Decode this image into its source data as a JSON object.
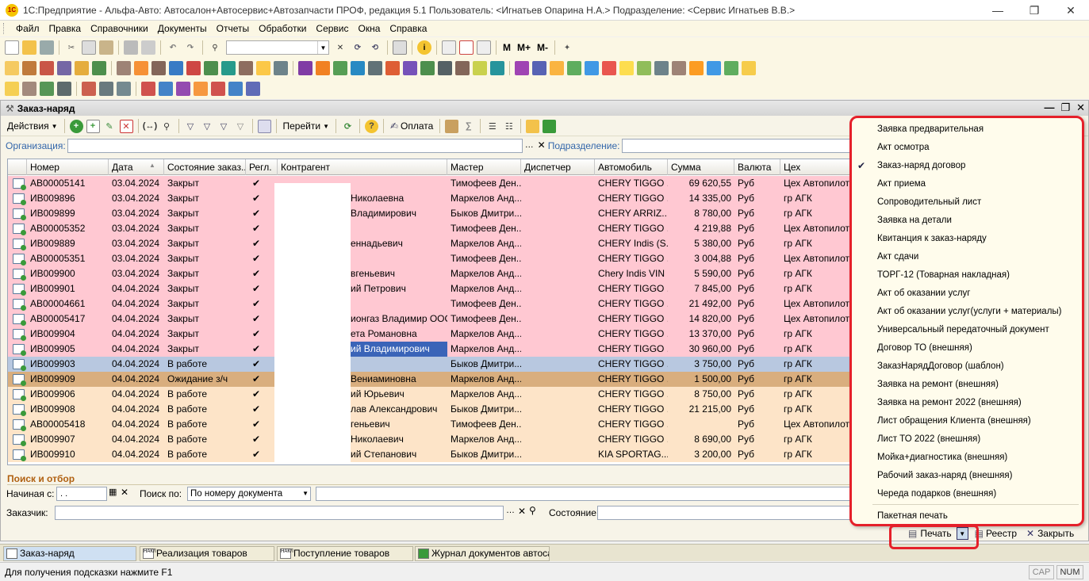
{
  "window": {
    "title": "1С:Предприятие - Альфа-Авто: Автосалон+Автосервис+Автозапчасти ПРОФ, редакция 5.1    Пользователь: <Игнатьев Опарина Н.А.>    Подразделение: <Сервис Игнатьев В.В.>",
    "logo": "1С"
  },
  "menu": [
    "Файл",
    "Правка",
    "Справочники",
    "Документы",
    "Отчеты",
    "Обработки",
    "Сервис",
    "Окна",
    "Справка"
  ],
  "toolbar1": {
    "m_buttons": [
      "M",
      "M+",
      "M-"
    ]
  },
  "doc": {
    "title": "Заказ-наряд",
    "toolbar": {
      "actions": "Действия",
      "goto": "Перейти",
      "pay": "Оплата"
    },
    "filter": {
      "org_label": "Организация:",
      "org_value": "",
      "dept_label": "Подразделение:",
      "dept_value": ""
    },
    "columns": [
      "",
      "Номер",
      "Дата",
      "Состояние заказ...",
      "Регл.",
      "Контрагент",
      "Мастер",
      "Диспетчер",
      "Автомобиль",
      "Сумма",
      "Валюта",
      "Цех"
    ],
    "rows": [
      {
        "num": "АВ00005141",
        "date": "03.04.2024",
        "state": "Закрыт",
        "reg": "✔",
        "contr": "",
        "master": "Тимофеев Ден...",
        "disp": "",
        "car": "CHERY TIGGO ...",
        "sum": "69 620,55",
        "cur": "Руб",
        "shop": "Цех Автопилот",
        "color": "#ffc8d2"
      },
      {
        "num": "ИВ009896",
        "date": "03.04.2024",
        "state": "Закрыт",
        "reg": "✔",
        "contr": "Николаевна",
        "master": "Маркелов Анд...",
        "disp": "",
        "car": "CHERY TIGGO ...",
        "sum": "14 335,00",
        "cur": "Руб",
        "shop": "гр АГК",
        "color": "#ffc8d2"
      },
      {
        "num": "ИВ009899",
        "date": "03.04.2024",
        "state": "Закрыт",
        "reg": "✔",
        "contr": "Владимирович",
        "master": "Быков Дмитри...",
        "disp": "",
        "car": "CHERY ARRIZ...",
        "sum": "8 780,00",
        "cur": "Руб",
        "shop": "гр АГК",
        "color": "#ffc8d2"
      },
      {
        "num": "АВ00005352",
        "date": "03.04.2024",
        "state": "Закрыт",
        "reg": "✔",
        "contr": "",
        "master": "Тимофеев Ден...",
        "disp": "",
        "car": "CHERY TIGGO ...",
        "sum": "4 219,88",
        "cur": "Руб",
        "shop": "Цех Автопилот",
        "color": "#ffc8d2"
      },
      {
        "num": "ИВ009889",
        "date": "03.04.2024",
        "state": "Закрыт",
        "reg": "✔",
        "contr": "еннадьевич",
        "master": "Маркелов Анд...",
        "disp": "",
        "car": "CHERY Indis (S...",
        "sum": "5 380,00",
        "cur": "Руб",
        "shop": "гр АГК",
        "color": "#ffc8d2"
      },
      {
        "num": "АВ00005351",
        "date": "03.04.2024",
        "state": "Закрыт",
        "reg": "✔",
        "contr": "",
        "master": "Тимофеев Ден...",
        "disp": "",
        "car": "CHERY TIGGO ...",
        "sum": "3 004,88",
        "cur": "Руб",
        "shop": "Цех Автопилот",
        "color": "#ffc8d2"
      },
      {
        "num": "ИВ009900",
        "date": "03.04.2024",
        "state": "Закрыт",
        "reg": "✔",
        "contr": "вгеньевич",
        "master": "Маркелов Анд...",
        "disp": "",
        "car": "Chery Indis VIN ...",
        "sum": "5 590,00",
        "cur": "Руб",
        "shop": "гр АГК",
        "color": "#ffc8d2"
      },
      {
        "num": "ИВ009901",
        "date": "04.04.2024",
        "state": "Закрыт",
        "reg": "✔",
        "contr": "ий Петрович",
        "master": "Маркелов Анд...",
        "disp": "",
        "car": "CHERY TIGGO ...",
        "sum": "7 845,00",
        "cur": "Руб",
        "shop": "гр АГК",
        "color": "#ffc8d2"
      },
      {
        "num": "АВ00004661",
        "date": "04.04.2024",
        "state": "Закрыт",
        "reg": "✔",
        "contr": "",
        "master": "Тимофеев Ден...",
        "disp": "",
        "car": "CHERY TIGGO ...",
        "sum": "21 492,00",
        "cur": "Руб",
        "shop": "Цех Автопилот",
        "color": "#ffc8d2"
      },
      {
        "num": "АВ00005417",
        "date": "04.04.2024",
        "state": "Закрыт",
        "reg": "✔",
        "contr": "ионгаз Владимир ООО",
        "master": "Тимофеев Ден...",
        "disp": "",
        "car": "CHERY TIGGO ...",
        "sum": "14 820,00",
        "cur": "Руб",
        "shop": "Цех Автопилот",
        "color": "#ffc8d2"
      },
      {
        "num": "ИВ009904",
        "date": "04.04.2024",
        "state": "Закрыт",
        "reg": "✔",
        "contr": "ета Романовна",
        "master": "Маркелов Анд...",
        "disp": "",
        "car": "CHERY TIGGO ...",
        "sum": "13 370,00",
        "cur": "Руб",
        "shop": "гр АГК",
        "color": "#ffc8d2"
      },
      {
        "num": "ИВ009905",
        "date": "04.04.2024",
        "state": "Закрыт",
        "reg": "✔",
        "contr": "ий Владимирович",
        "master": "Маркелов Анд...",
        "disp": "",
        "car": "CHERY TIGGO ...",
        "sum": "30 960,00",
        "cur": "Руб",
        "shop": "гр АГК",
        "color": "#ffc8d2",
        "contrSel": true
      },
      {
        "num": "ИВ009903",
        "date": "04.04.2024",
        "state": "В работе",
        "reg": "✔",
        "contr": "",
        "master": "Быков Дмитри...",
        "disp": "",
        "car": "CHERY TIGGO ...",
        "sum": "3 750,00",
        "cur": "Руб",
        "shop": "гр АГК",
        "color": "#b8c8e0"
      },
      {
        "num": "ИВ009909",
        "date": "04.04.2024",
        "state": "Ожидание з/ч",
        "reg": "✔",
        "contr": "Вениаминовна",
        "master": "Маркелов Анд...",
        "disp": "",
        "car": "CHERY TIGGO ...",
        "sum": "1 500,00",
        "cur": "Руб",
        "shop": "гр АГК",
        "color": "#d9ae7e"
      },
      {
        "num": "ИВ009906",
        "date": "04.04.2024",
        "state": "В работе",
        "reg": "✔",
        "contr": "ий Юрьевич",
        "master": "Маркелов Анд...",
        "disp": "",
        "car": "CHERY TIGGO ...",
        "sum": "8 750,00",
        "cur": "Руб",
        "shop": "гр АГК",
        "color": "#fde4c8"
      },
      {
        "num": "ИВ009908",
        "date": "04.04.2024",
        "state": "В работе",
        "reg": "✔",
        "contr": "лав Александрович",
        "master": "Быков Дмитри...",
        "disp": "",
        "car": "CHERY TIGGO ...",
        "sum": "21 215,00",
        "cur": "Руб",
        "shop": "гр АГК",
        "color": "#fde4c8"
      },
      {
        "num": "АВ00005418",
        "date": "04.04.2024",
        "state": "В работе",
        "reg": "✔",
        "contr": "геньевич",
        "master": "Тимофеев Ден...",
        "disp": "",
        "car": "CHERY TIGGO ...",
        "sum": "",
        "cur": "Руб",
        "shop": "Цех Автопилот",
        "color": "#fde4c8"
      },
      {
        "num": "ИВ009907",
        "date": "04.04.2024",
        "state": "В работе",
        "reg": "✔",
        "contr": "Николаевич",
        "master": "Маркелов Анд...",
        "disp": "",
        "car": "CHERY TIGGO ...",
        "sum": "8 690,00",
        "cur": "Руб",
        "shop": "гр АГК",
        "color": "#fde4c8"
      },
      {
        "num": "ИВ009910",
        "date": "04.04.2024",
        "state": "В работе",
        "reg": "✔",
        "contr": "ий Степанович",
        "master": "Быков Дмитри...",
        "disp": "",
        "car": "KIA SPORTAG...",
        "sum": "3 200,00",
        "cur": "Руб",
        "shop": "гр АГК",
        "color": "#fde4c8"
      }
    ],
    "search": {
      "title": "Поиск и отбор",
      "from_label": "Начиная с:",
      "from_value": ". .",
      "by_label": "Поиск по:",
      "by_value": "По номеру документа",
      "customer_label": "Заказчик:",
      "state_label": "Состояние:"
    },
    "bottom": {
      "print": "Печать",
      "registry": "Реестр",
      "close": "Закрыть"
    }
  },
  "popup": {
    "items": [
      {
        "label": "Заявка предварительная"
      },
      {
        "label": "Акт осмотра"
      },
      {
        "label": "Заказ-наряд договор",
        "checked": true
      },
      {
        "label": "Акт приема"
      },
      {
        "label": "Сопроводительный лист"
      },
      {
        "label": "Заявка на детали"
      },
      {
        "label": "Квитанция к заказ-наряду"
      },
      {
        "label": "Акт сдачи"
      },
      {
        "label": "ТОРГ-12 (Товарная накладная)"
      },
      {
        "label": "Акт об оказании услуг"
      },
      {
        "label": "Акт об оказании услуг(услуги + материалы)"
      },
      {
        "label": "Универсальный передаточный документ"
      },
      {
        "label": "Договор ТО (внешняя)"
      },
      {
        "label": "ЗаказНарядДоговор (шаблон)"
      },
      {
        "label": "Заявка на ремонт (внешняя)"
      },
      {
        "label": "Заявка на ремонт  2022 (внешняя)"
      },
      {
        "label": "Лист обращения Клиента (внешняя)"
      },
      {
        "label": "Лист ТО 2022 (внешняя)"
      },
      {
        "label": "Мойка+диагностика (внешняя)"
      },
      {
        "label": "Рабочий заказ-наряд (внешняя)"
      },
      {
        "label": "Череда подарков (внешняя)"
      }
    ],
    "batch": "Пакетная печать"
  },
  "tabs": [
    "Заказ-наряд",
    "Реализация товаров",
    "Поступление товаров",
    "Журнал документов автоса..."
  ],
  "tab_icon_text": "НАКЛ",
  "status": {
    "hint": "Для получения подсказки нажмите F1",
    "cap": "CAP",
    "num": "NUM"
  },
  "colors": {
    "accent_red": "#e5202a",
    "closed_row": "#ffc8d2",
    "in_work_row": "#fde4c8",
    "waiting_row": "#d9ae7e",
    "selected_row": "#b8c8e0"
  }
}
